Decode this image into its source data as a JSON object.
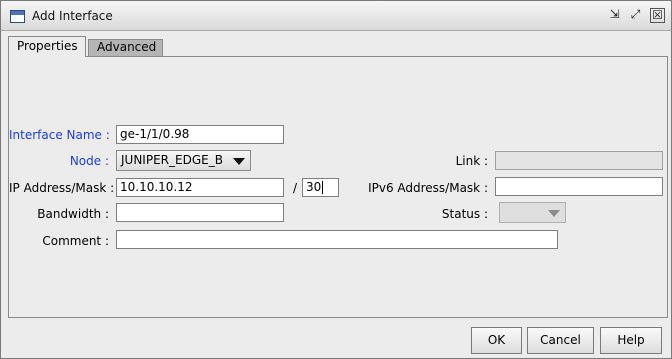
{
  "window": {
    "title": "Add Interface",
    "buttons": {
      "minimize": "⇲",
      "maximize": "⤢",
      "close": "☒"
    }
  },
  "tabs": [
    {
      "label": "Properties",
      "active": true
    },
    {
      "label": "Advanced",
      "active": false
    }
  ],
  "form": {
    "interface_name": {
      "label": "Interface Name :",
      "value": "ge-1/1/0.98"
    },
    "node": {
      "label": "Node :",
      "value": "JUNIPER_EDGE_B"
    },
    "ip_mask": {
      "label": "IP Address/Mask :",
      "value": "10.10.10.12",
      "separator": "/",
      "mask": "30"
    },
    "bandwidth": {
      "label": "Bandwidth :",
      "value": ""
    },
    "comment": {
      "label": "Comment :",
      "value": ""
    },
    "link": {
      "label": "Link :",
      "value": ""
    },
    "ipv6_mask": {
      "label": "IPv6 Address/Mask :",
      "value": ""
    },
    "status": {
      "label": "Status :",
      "value": ""
    }
  },
  "actions": {
    "ok": "OK",
    "cancel": "Cancel",
    "help": "Help"
  },
  "colors": {
    "required_label": "#1f3fcf",
    "window_bg": "#ececec",
    "inactive_tab": "#b5b5b5"
  }
}
